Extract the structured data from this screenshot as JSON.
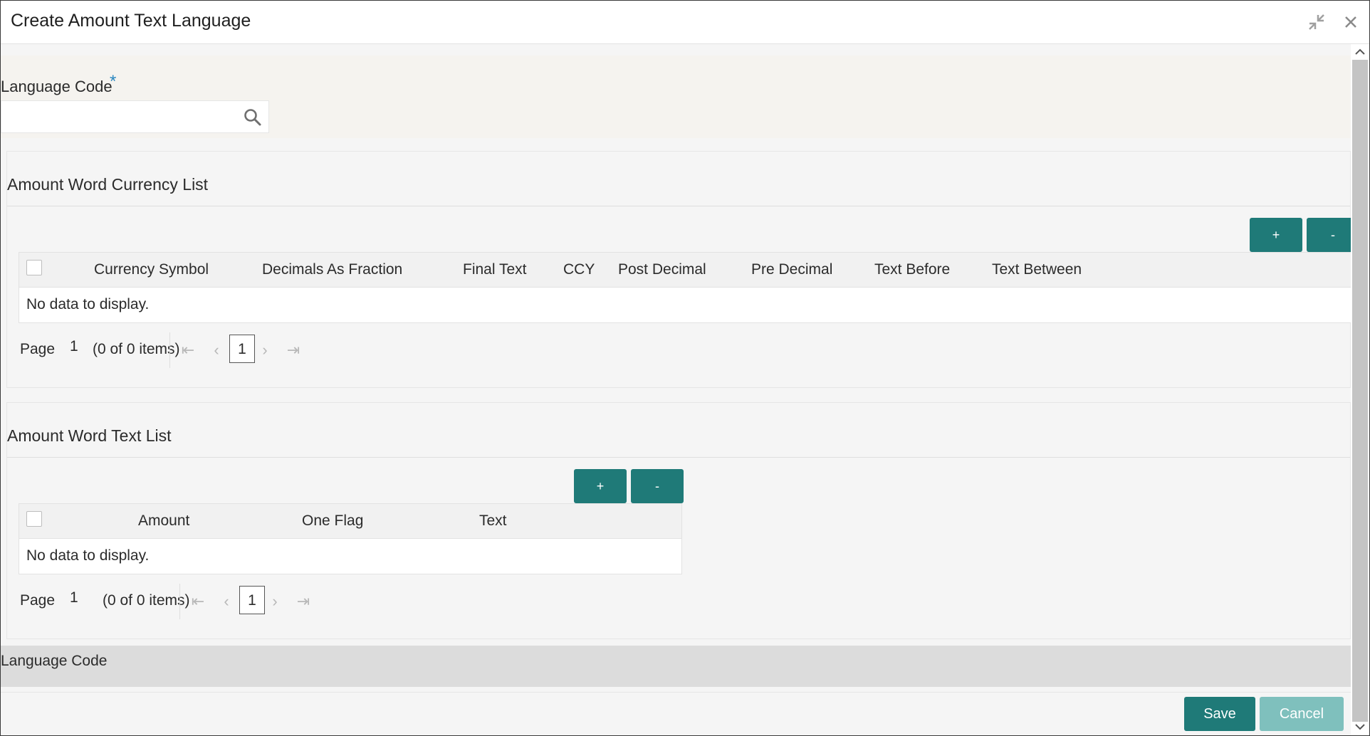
{
  "window": {
    "title": "Create Amount Text Language"
  },
  "form": {
    "language_code_label": "Language Code",
    "required_marker": "*",
    "language_code_value": ""
  },
  "currency_panel": {
    "title": "Amount Word Currency List",
    "add_label": "+",
    "remove_label": "-",
    "columns": [
      "Currency Symbol",
      "Decimals As Fraction",
      "Final Text",
      "CCY",
      "Post Decimal",
      "Pre Decimal",
      "Text Before",
      "Text Between"
    ],
    "empty_text": "No data to display.",
    "pager": {
      "page_label": "Page",
      "page_number": "1",
      "items_text": "(0 of 0 items)",
      "current_page": "1"
    }
  },
  "text_panel": {
    "title": "Amount Word Text List",
    "add_label": "+",
    "remove_label": "-",
    "columns": [
      "Amount",
      "One Flag",
      "Text"
    ],
    "empty_text": "No data to display.",
    "pager": {
      "page_label": "Page",
      "page_number": "1",
      "items_text": "(0 of 0 items)",
      "current_page": "1"
    }
  },
  "footer": {
    "label": "Language Code"
  },
  "actions": {
    "save_label": "Save",
    "cancel_label": "Cancel"
  },
  "colors": {
    "accent": "#1f7a78",
    "accent_disabled": "#7fc0bd",
    "required": "#2a87c0"
  },
  "icons": {
    "minimize": "collapse-icon",
    "close": "close-icon",
    "search": "search-icon",
    "first": "first-page-icon",
    "prev": "prev-page-icon",
    "next": "next-page-icon",
    "last": "last-page-icon"
  }
}
